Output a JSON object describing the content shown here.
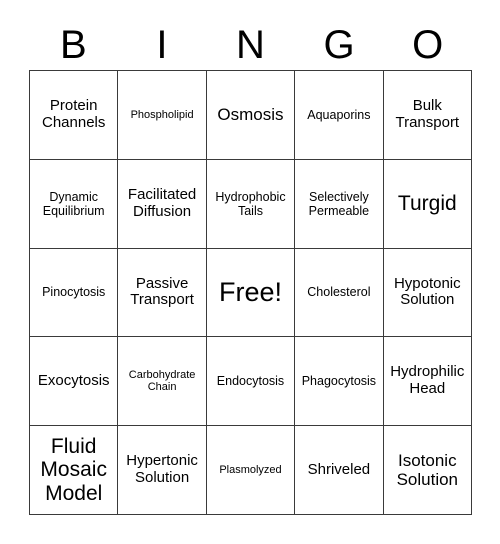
{
  "card": {
    "title_letters": [
      "B",
      "I",
      "N",
      "G",
      "O"
    ],
    "border_color": "#3a3a3a",
    "text_color": "#000000",
    "background_color": "#ffffff",
    "rows": 5,
    "columns": 5,
    "free_space": "Free!",
    "cells": [
      [
        {
          "text": "Protein Channels",
          "size": "md",
          "free": false
        },
        {
          "text": "Phospholipid",
          "size": "xs",
          "free": false
        },
        {
          "text": "Osmosis",
          "size": "lg",
          "free": false
        },
        {
          "text": "Aquaporins",
          "size": "sm",
          "free": false
        },
        {
          "text": "Bulk Transport",
          "size": "md",
          "free": false
        }
      ],
      [
        {
          "text": "Dynamic Equilibrium",
          "size": "sm",
          "free": false
        },
        {
          "text": "Facilitated Diffusion",
          "size": "md",
          "free": false
        },
        {
          "text": "Hydrophobic Tails",
          "size": "sm",
          "free": false
        },
        {
          "text": "Selectively Permeable",
          "size": "sm",
          "free": false
        },
        {
          "text": "Turgid",
          "size": "xl",
          "free": false
        }
      ],
      [
        {
          "text": "Pinocytosis",
          "size": "sm",
          "free": false
        },
        {
          "text": "Passive Transport",
          "size": "md",
          "free": false
        },
        {
          "text": "Free!",
          "size": "xxl",
          "free": true
        },
        {
          "text": "Cholesterol",
          "size": "sm",
          "free": false
        },
        {
          "text": "Hypotonic Solution",
          "size": "md",
          "free": false
        }
      ],
      [
        {
          "text": "Exocytosis",
          "size": "md",
          "free": false
        },
        {
          "text": "Carbohydrate Chain",
          "size": "xs",
          "free": false
        },
        {
          "text": "Endocytosis",
          "size": "sm",
          "free": false
        },
        {
          "text": "Phagocytosis",
          "size": "sm",
          "free": false
        },
        {
          "text": "Hydrophilic Head",
          "size": "md",
          "free": false
        }
      ],
      [
        {
          "text": "Fluid Mosaic Model",
          "size": "xl",
          "free": false
        },
        {
          "text": "Hypertonic Solution",
          "size": "md",
          "free": false
        },
        {
          "text": "Plasmolyzed",
          "size": "xs",
          "free": false
        },
        {
          "text": "Shriveled",
          "size": "md",
          "free": false
        },
        {
          "text": "Isotonic Solution",
          "size": "lg",
          "free": false
        }
      ]
    ]
  }
}
